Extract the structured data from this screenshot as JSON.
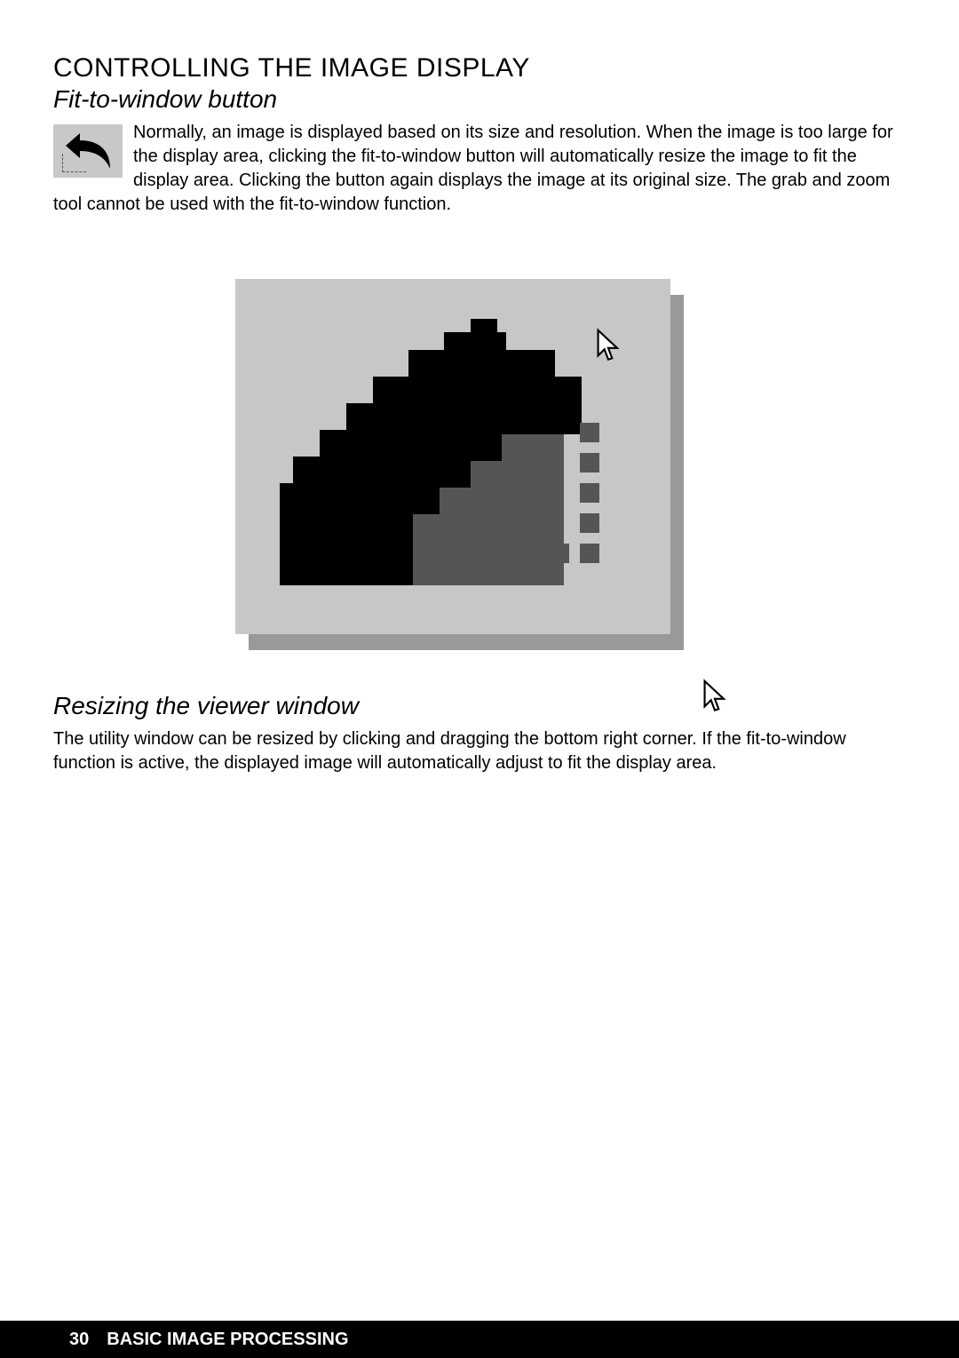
{
  "heading_main": "CONTROLLING THE IMAGE DISPLAY",
  "section_fit": {
    "title": "Fit-to-window button",
    "body": "Normally, an image is displayed based on its size and resolution. When the image is too large for the display area, clicking the fit-to-window button will automatically resize the image to fit the display area. Clicking the button again displays the image at its original size. The grab and zoom tool cannot be used with the fit-to-window function."
  },
  "section_resize": {
    "title": "Resizing the viewer window",
    "body": "The utility window can be resized by clicking and dragging the bottom right corner. If the fit-to-window function is active, the displayed image will automatically adjust to fit the display area."
  },
  "footer": {
    "page_number": "30",
    "chapter": "BASIC IMAGE PROCESSING"
  }
}
